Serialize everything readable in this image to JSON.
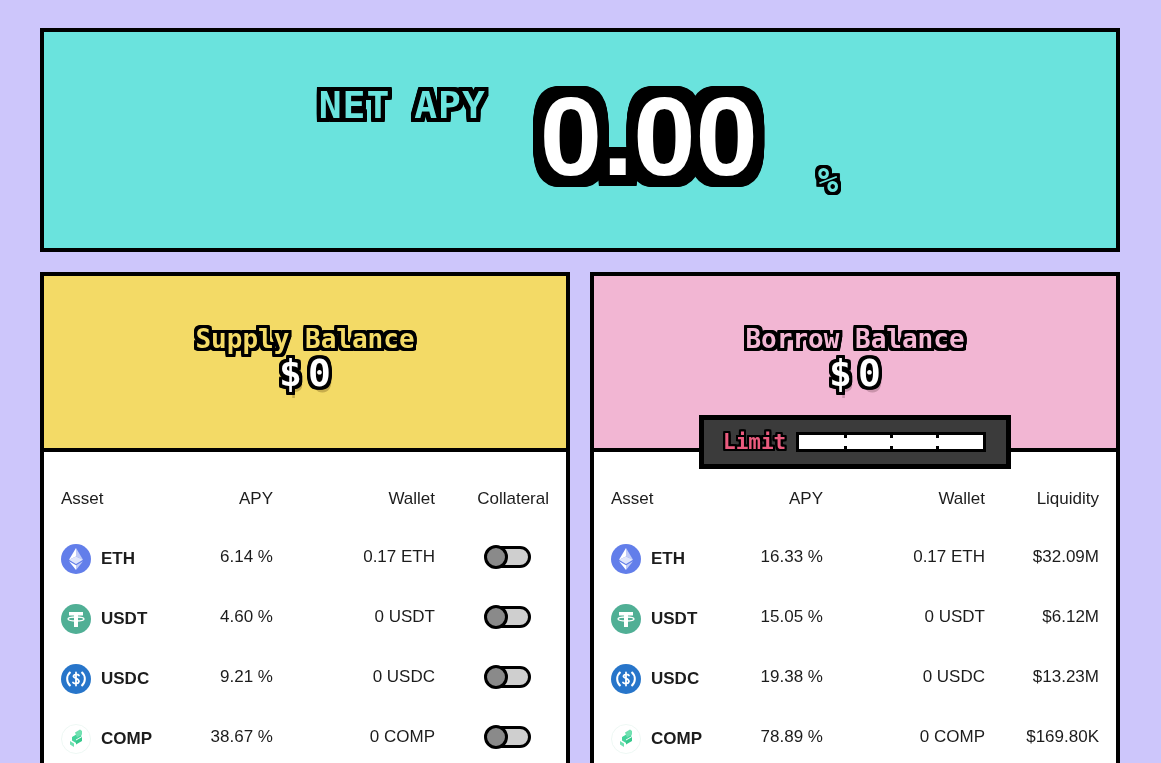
{
  "net_apy": {
    "label": "NET APY",
    "value": "0.00",
    "unit": "%"
  },
  "supply": {
    "title": "Supply Balance",
    "balance": "$0",
    "columns": [
      "Asset",
      "APY",
      "Wallet",
      "Collateral"
    ],
    "rows": [
      {
        "kind": "diamond",
        "asset": "ETH",
        "apy": "6.14 %",
        "wallet": "0.17 ETH",
        "collateral_on": false
      },
      {
        "kind": "letter-t",
        "asset": "USDT",
        "apy": "4.60 %",
        "wallet": "0 USDT",
        "collateral_on": false
      },
      {
        "kind": "dollar",
        "asset": "USDC",
        "apy": "9.21 %",
        "wallet": "0 USDC",
        "collateral_on": false
      },
      {
        "kind": "stack",
        "asset": "COMP",
        "apy": "38.67 %",
        "wallet": "0 COMP",
        "collateral_on": false
      }
    ]
  },
  "borrow": {
    "title": "Borrow Balance",
    "balance": "$0",
    "limit": {
      "label": "Limit",
      "level": 0
    },
    "columns": [
      "Asset",
      "APY",
      "Wallet",
      "Liquidity"
    ],
    "rows": [
      {
        "kind": "diamond",
        "asset": "ETH",
        "apy": "16.33 %",
        "wallet": "0.17 ETH",
        "liquidity": "$32.09M"
      },
      {
        "kind": "letter-t",
        "asset": "USDT",
        "apy": "15.05 %",
        "wallet": "0 USDT",
        "liquidity": "$6.12M"
      },
      {
        "kind": "dollar",
        "asset": "USDC",
        "apy": "19.38 %",
        "wallet": "0 USDC",
        "liquidity": "$13.23M"
      },
      {
        "kind": "stack",
        "asset": "COMP",
        "apy": "78.89 %",
        "wallet": "0 COMP",
        "liquidity": "$169.80K"
      }
    ]
  }
}
